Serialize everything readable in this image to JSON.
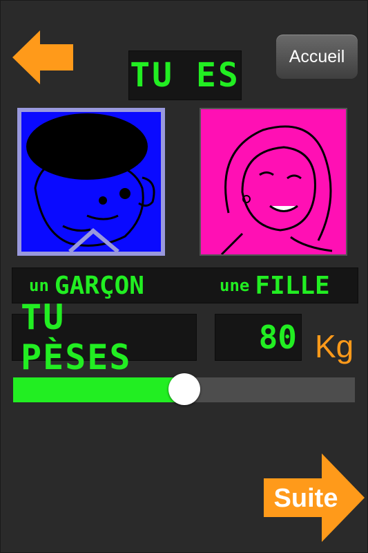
{
  "title": "TU ES",
  "nav": {
    "home_label": "Accueil",
    "next_label": "Suite"
  },
  "gender": {
    "boy_prefix": "un",
    "boy_word": "GARÇON",
    "girl_prefix": "une",
    "girl_word": "FILLE"
  },
  "weight": {
    "label": "TU PÈSES",
    "value": "80",
    "unit": "Kg",
    "slider_fraction": 0.5
  },
  "colors": {
    "lcd_green": "#22ee22",
    "orange": "#ff9a1a",
    "boy_bg": "#0a0aff",
    "girl_bg": "#ff10b4"
  },
  "icons": {
    "back": "arrow-left-icon",
    "next": "arrow-right-icon"
  }
}
